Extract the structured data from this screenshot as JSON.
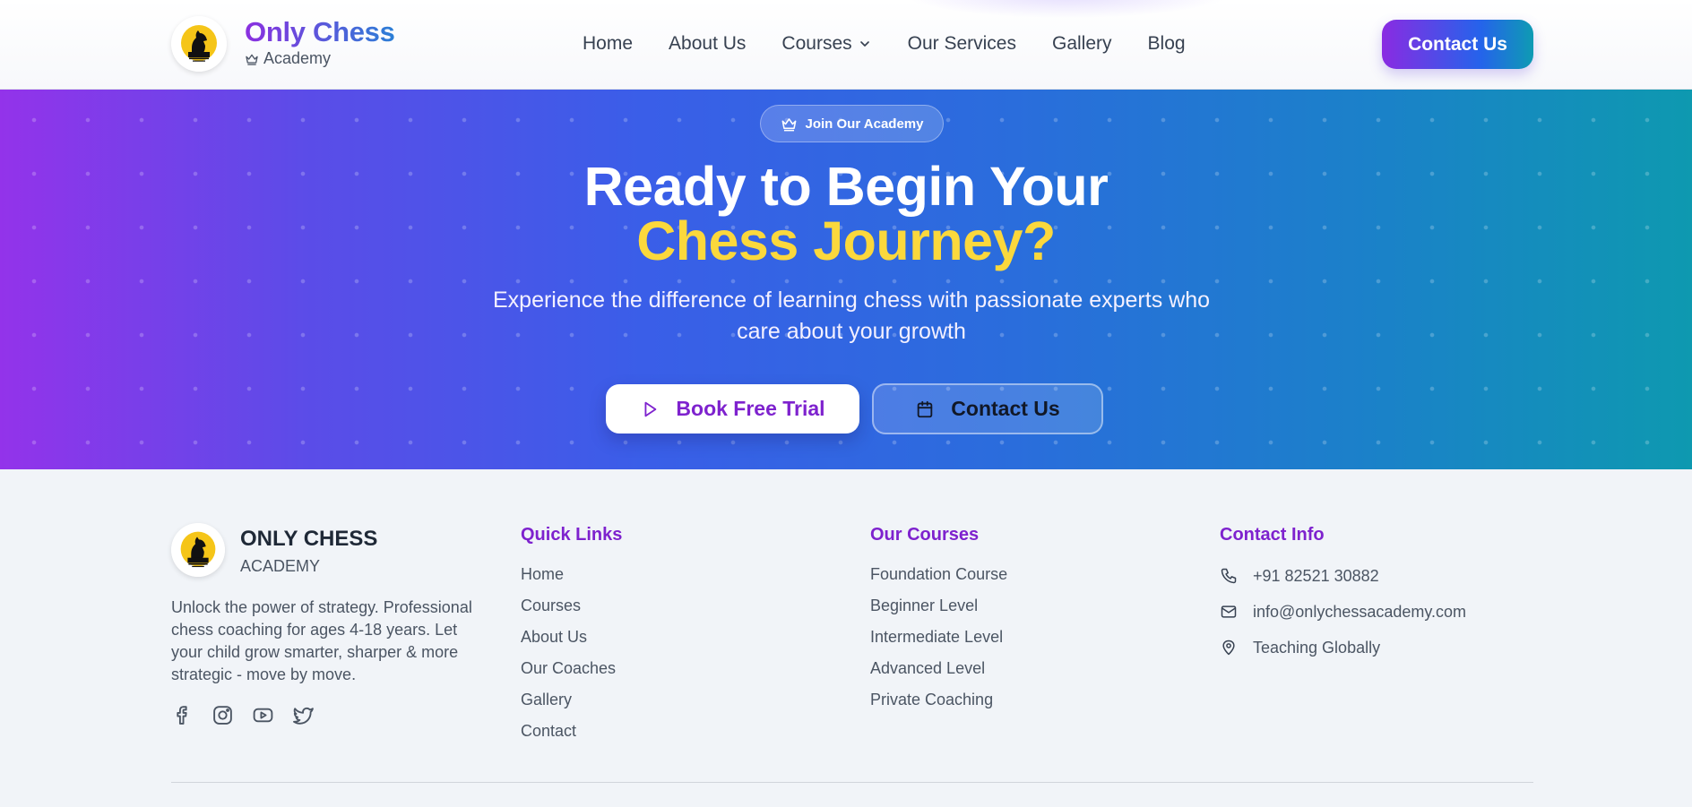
{
  "header": {
    "brand_name": "Only Chess",
    "brand_sub": "Academy",
    "nav": [
      {
        "label": "Home"
      },
      {
        "label": "About Us"
      },
      {
        "label": "Courses",
        "has_dropdown": true
      },
      {
        "label": "Our Services"
      },
      {
        "label": "Gallery"
      },
      {
        "label": "Blog"
      }
    ],
    "cta_label": "Contact Us"
  },
  "hero": {
    "badge": "Join Our Academy",
    "title_line1": "Ready to Begin Your",
    "title_line2": "Chess Journey?",
    "subtitle": "Experience the difference of learning chess with passionate experts who care about your growth",
    "primary_button": "Book Free Trial",
    "secondary_button": "Contact Us"
  },
  "footer": {
    "logo_name": "ONLY CHESS",
    "logo_sub": "ACADEMY",
    "description": "Unlock the power of strategy. Professional chess coaching for ages 4-18 years. Let your child grow smarter, sharper & more strategic - move by move.",
    "socials": [
      "facebook-icon",
      "instagram-icon",
      "youtube-icon",
      "twitter-icon"
    ],
    "quick_links": {
      "title": "Quick Links",
      "items": [
        "Home",
        "Courses",
        "About Us",
        "Our Coaches",
        "Gallery",
        "Contact"
      ]
    },
    "courses": {
      "title": "Our Courses",
      "items": [
        "Foundation Course",
        "Beginner Level",
        "Intermediate Level",
        "Advanced Level",
        "Private Coaching"
      ]
    },
    "contact": {
      "title": "Contact Info",
      "phone": "+91 82521 30882",
      "email": "info@onlychessacademy.com",
      "location": "Teaching Globally"
    }
  },
  "colors": {
    "brand_purple": "#7e22ce",
    "brand_blue": "#2563eb",
    "brand_teal": "#0e99b0",
    "accent_yellow": "#fbd83c"
  }
}
